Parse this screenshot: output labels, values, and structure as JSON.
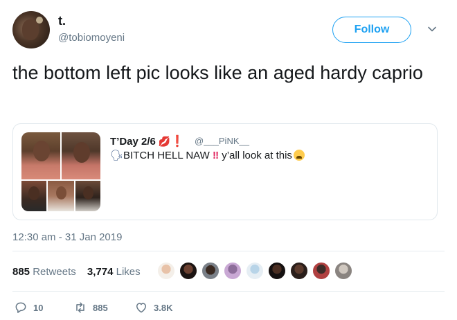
{
  "author": {
    "name": "t.",
    "handle": "@tobiomoyeni"
  },
  "follow_label": "Follow",
  "tweet_text": "the bottom left pic looks like an aged hardy caprio",
  "quoted": {
    "name": "T’Day 2/6",
    "handle": "@___PiNK__",
    "text_prefix": "BITCH HELL NAW",
    "text_suffix": " y’all look at this"
  },
  "timestamp": "12:30 am - 31 Jan 2019",
  "stats": {
    "retweets_count": "885",
    "retweets_label": "Retweets",
    "likes_count": "3,774",
    "likes_label": "Likes"
  },
  "actions": {
    "replies": "10",
    "retweets": "885",
    "likes": "3.8K"
  },
  "icons": {
    "caret": "chevron-down-icon",
    "reply": "reply-icon",
    "retweet": "retweet-icon",
    "like": "heart-icon"
  },
  "colors": {
    "accent": "#1da1f2",
    "muted": "#657786",
    "border": "#e1e8ed"
  }
}
